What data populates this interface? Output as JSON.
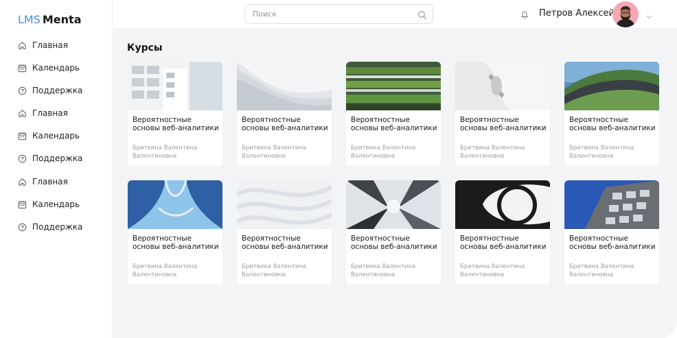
{
  "app": {
    "brand": "LMS",
    "name": "Menta"
  },
  "sidebar": {
    "items": [
      {
        "label": "Главная",
        "icon": "home-icon"
      },
      {
        "label": "Календарь",
        "icon": "calendar-icon"
      },
      {
        "label": "Поддержка",
        "icon": "help-icon"
      },
      {
        "label": "Главная",
        "icon": "home-icon"
      },
      {
        "label": "Календарь",
        "icon": "calendar-icon"
      },
      {
        "label": "Поддержка",
        "icon": "help-icon"
      },
      {
        "label": "Главная",
        "icon": "home-icon"
      },
      {
        "label": "Календарь",
        "icon": "calendar-icon"
      },
      {
        "label": "Поддержка",
        "icon": "help-icon"
      }
    ]
  },
  "header": {
    "search_placeholder": "Поиск",
    "user_name": "Петров Алексей"
  },
  "main": {
    "title": "Курсы",
    "courses": [
      {
        "title": "Вероятностные основы веб-аналитики",
        "author": "Бритвина Валентина Валентиновна",
        "image": "white-building-facade"
      },
      {
        "title": "Вероятностные основы веб-аналитики",
        "author": "Бритвина Валентина Валентиновна",
        "image": "white-wave-architecture"
      },
      {
        "title": "Вероятностные основы веб-аналитики",
        "author": "Бритвина Валентина Валентиновна",
        "image": "green-terraced-building"
      },
      {
        "title": "Вероятностные основы веб-аналитики",
        "author": "Бритвина Валентина Валентиновна",
        "image": "white-curved-architecture"
      },
      {
        "title": "Вероятностные основы веб-аналитики",
        "author": "Бритвина Валентина Валентиновна",
        "image": "green-roof-building"
      },
      {
        "title": "Вероятностные основы веб-аналитики",
        "author": "Бритвина Валентина Валентиновна",
        "image": "blue-curved-tower"
      },
      {
        "title": "Вероятностные основы веб-аналитики",
        "author": "Бритвина Валентина Валентиновна",
        "image": "white-wave-abstract"
      },
      {
        "title": "Вероятностные основы веб-аналитики",
        "author": "Бритвина Валентина Валентиновна",
        "image": "skyscrapers-from-below"
      },
      {
        "title": "Вероятностные основы веб-аналитики",
        "author": "Бритвина Валентина Валентиновна",
        "image": "black-spiral-structure"
      },
      {
        "title": "Вероятностные основы веб-аналитики",
        "author": "Бритвина Валентина Валентиновна",
        "image": "modern-glass-building"
      }
    ]
  },
  "colors": {
    "accent": "#3d8fef",
    "background": "#f3f4f6",
    "card": "#ffffff",
    "muted_text": "#9a9ea5"
  }
}
